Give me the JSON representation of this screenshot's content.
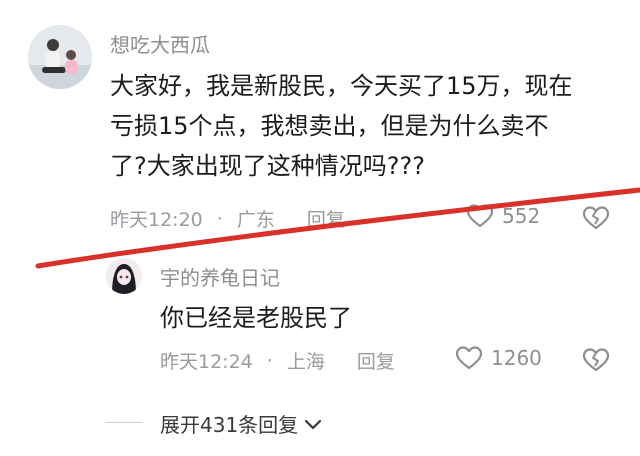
{
  "comment": {
    "username": "想吃大西瓜",
    "lines": [
      "大家好，我是新股民，今天买了15万，现在",
      "亏损15个点，我想卖出，但是为什么卖不",
      "了?大家出现了这种情况吗???"
    ],
    "time": "昨天12:20",
    "location": "广东",
    "reply_label": "回复",
    "likes": "552"
  },
  "reply": {
    "username": "宇的养龟日记",
    "text": "你已经是老股民了",
    "time": "昨天12:24",
    "location": "上海",
    "reply_label": "回复",
    "likes": "1260"
  },
  "expand": {
    "label": "展开431条回复"
  },
  "icons": {
    "like": "heart-outline-icon",
    "dislike": "broken-heart-icon",
    "expand": "chevron-down-icon"
  },
  "colors": {
    "annotation_line": "#d9302a"
  }
}
